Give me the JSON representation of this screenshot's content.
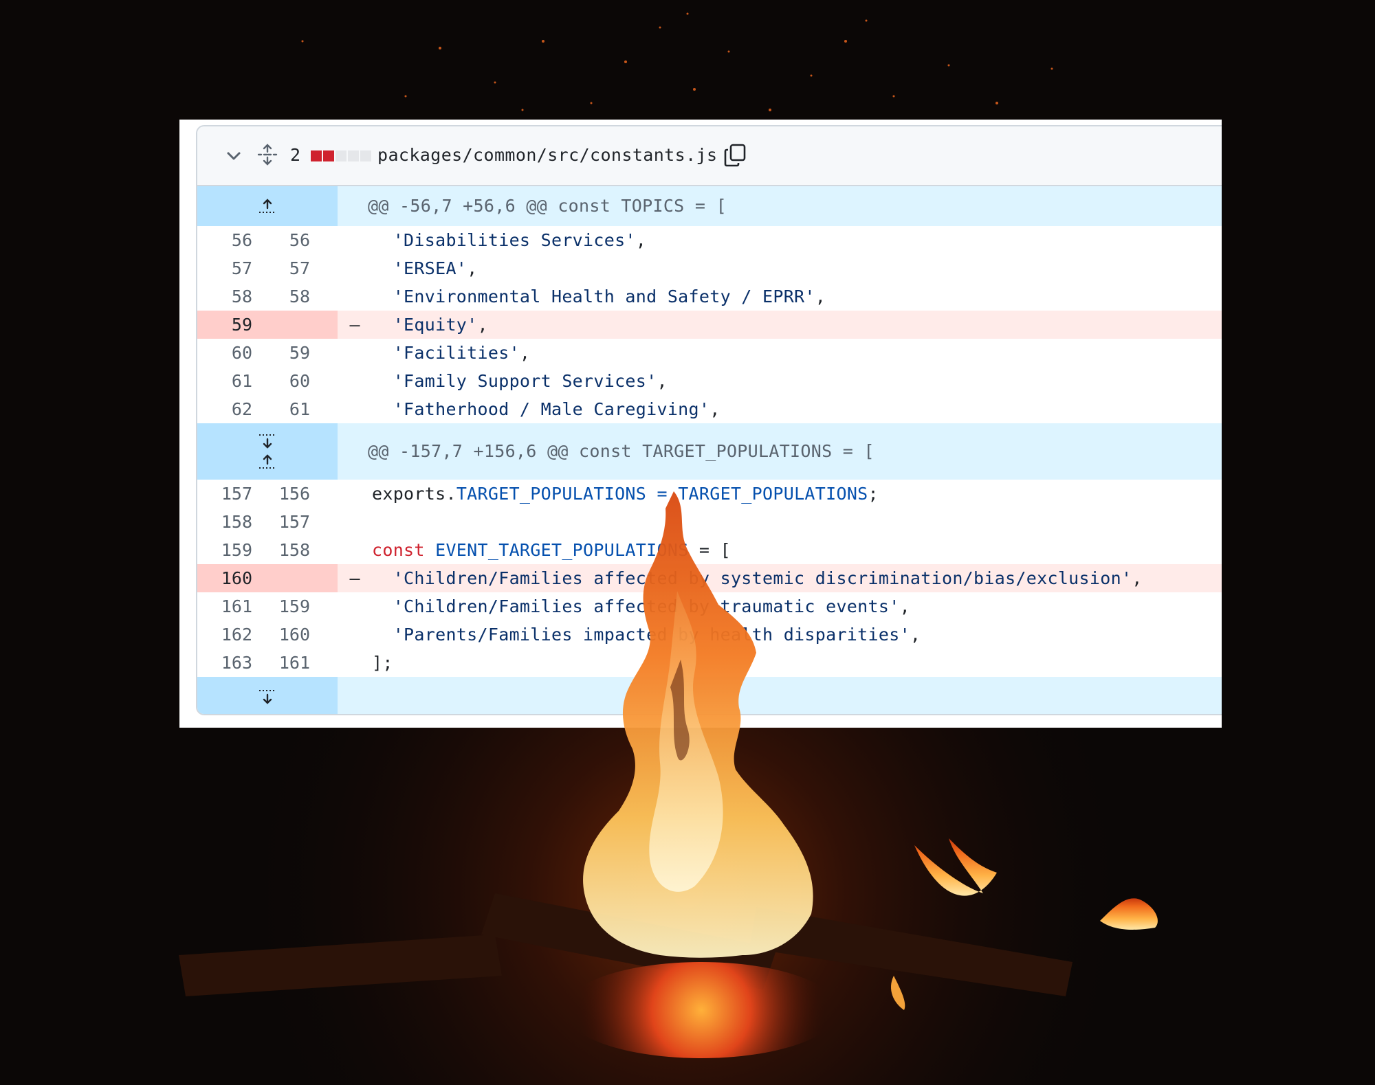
{
  "file": {
    "changes_count": "2",
    "path": "packages/common/src/constants.js",
    "diffstat": [
      "del",
      "del",
      "neu",
      "neu",
      "neu"
    ]
  },
  "hunks": [
    {
      "header": "@@ -56,7 +56,6 @@ const TOPICS = [",
      "lines": [
        {
          "type": "ctx",
          "old": "56",
          "new": "56",
          "sign": "",
          "tokens": [
            {
              "t": "  ",
              "c": "pl"
            },
            {
              "t": "'Disabilities Services'",
              "c": "str"
            },
            {
              "t": ",",
              "c": "pl"
            }
          ]
        },
        {
          "type": "ctx",
          "old": "57",
          "new": "57",
          "sign": "",
          "tokens": [
            {
              "t": "  ",
              "c": "pl"
            },
            {
              "t": "'ERSEA'",
              "c": "str"
            },
            {
              "t": ",",
              "c": "pl"
            }
          ]
        },
        {
          "type": "ctx",
          "old": "58",
          "new": "58",
          "sign": "",
          "tokens": [
            {
              "t": "  ",
              "c": "pl"
            },
            {
              "t": "'Environmental Health and Safety / EPRR'",
              "c": "str"
            },
            {
              "t": ",",
              "c": "pl"
            }
          ]
        },
        {
          "type": "del",
          "old": "59",
          "new": "",
          "sign": "–",
          "tokens": [
            {
              "t": "  ",
              "c": "pl"
            },
            {
              "t": "'Equity'",
              "c": "str"
            },
            {
              "t": ",",
              "c": "pl"
            }
          ]
        },
        {
          "type": "ctx",
          "old": "60",
          "new": "59",
          "sign": "",
          "tokens": [
            {
              "t": "  ",
              "c": "pl"
            },
            {
              "t": "'Facilities'",
              "c": "str"
            },
            {
              "t": ",",
              "c": "pl"
            }
          ]
        },
        {
          "type": "ctx",
          "old": "61",
          "new": "60",
          "sign": "",
          "tokens": [
            {
              "t": "  ",
              "c": "pl"
            },
            {
              "t": "'Family Support Services'",
              "c": "str"
            },
            {
              "t": ",",
              "c": "pl"
            }
          ]
        },
        {
          "type": "ctx",
          "old": "62",
          "new": "61",
          "sign": "",
          "tokens": [
            {
              "t": "  ",
              "c": "pl"
            },
            {
              "t": "'Fatherhood / Male Caregiving'",
              "c": "str"
            },
            {
              "t": ",",
              "c": "pl"
            }
          ]
        }
      ]
    },
    {
      "header": "@@ -157,7 +156,6 @@ const TARGET_POPULATIONS = [",
      "lines": [
        {
          "type": "ctx",
          "old": "157",
          "new": "156",
          "sign": "",
          "tokens": [
            {
              "t": "exports.",
              "c": "pl"
            },
            {
              "t": "TARGET_POPULATIONS",
              "c": "var"
            },
            {
              "t": " = ",
              "c": "var"
            },
            {
              "t": "TARGET_POPULATIONS",
              "c": "var"
            },
            {
              "t": ";",
              "c": "pl"
            }
          ]
        },
        {
          "type": "ctx",
          "old": "158",
          "new": "157",
          "sign": "",
          "tokens": [
            {
              "t": "",
              "c": "pl"
            }
          ]
        },
        {
          "type": "ctx",
          "old": "159",
          "new": "158",
          "sign": "",
          "tokens": [
            {
              "t": "const ",
              "c": "kw"
            },
            {
              "t": "EVENT_TARGET_POPULATIONS",
              "c": "var"
            },
            {
              "t": " = ",
              "c": "pl"
            },
            {
              "t": "[",
              "c": "pl"
            }
          ]
        },
        {
          "type": "del",
          "old": "160",
          "new": "",
          "sign": "–",
          "tokens": [
            {
              "t": "  ",
              "c": "pl"
            },
            {
              "t": "'Children/Families affected by systemic discrimination/bias/exclusion'",
              "c": "str"
            },
            {
              "t": ",",
              "c": "pl"
            }
          ]
        },
        {
          "type": "ctx",
          "old": "161",
          "new": "159",
          "sign": "",
          "tokens": [
            {
              "t": "  ",
              "c": "pl"
            },
            {
              "t": "'Children/Families affected by traumatic events'",
              "c": "str"
            },
            {
              "t": ",",
              "c": "pl"
            }
          ]
        },
        {
          "type": "ctx",
          "old": "162",
          "new": "160",
          "sign": "",
          "tokens": [
            {
              "t": "  ",
              "c": "pl"
            },
            {
              "t": "'Parents/Families impacted by health disparities'",
              "c": "str"
            },
            {
              "t": ",",
              "c": "pl"
            }
          ]
        },
        {
          "type": "ctx",
          "old": "163",
          "new": "161",
          "sign": "",
          "tokens": [
            {
              "t": "];",
              "c": "pl"
            }
          ]
        }
      ]
    }
  ],
  "icons": {
    "collapse": "chevron-down-icon",
    "expand_all": "unfold-icon",
    "copy": "copy-icon",
    "expand_up": "fold-up-icon",
    "expand_down": "fold-down-icon"
  },
  "colors": {
    "deletion_bg": "#ffebe9",
    "deletion_gutter": "#ffcecb",
    "hunk_bg": "#ddf4ff",
    "hunk_gutter": "#b6e3ff",
    "diffstat_del": "#cf222e"
  }
}
